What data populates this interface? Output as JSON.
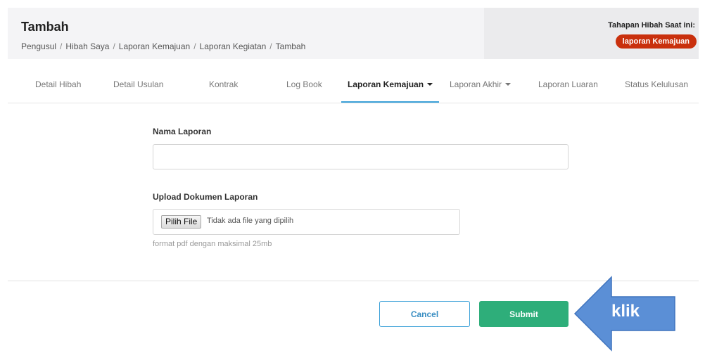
{
  "header": {
    "title": "Tambah",
    "breadcrumb": [
      "Pengusul",
      "Hibah Saya",
      "Laporan Kemajuan",
      "Laporan Kegiatan",
      "Tambah"
    ],
    "separator": "/",
    "stage_label": "Tahapan Hibah Saat ini:",
    "stage_badge": "laporan Kemajuan"
  },
  "tabs": [
    {
      "label": "Detail Hibah"
    },
    {
      "label": "Detail Usulan"
    },
    {
      "label": "Kontrak"
    },
    {
      "label": "Log Book"
    },
    {
      "label": "Laporan Kemajuan"
    },
    {
      "label": "Laporan Akhir"
    },
    {
      "label": "Laporan Luaran"
    },
    {
      "label": "Status Kelulusan"
    }
  ],
  "form": {
    "name_label": "Nama Laporan",
    "name_value": "",
    "upload_label": "Upload Dokumen Laporan",
    "file_button": "Pilih File",
    "file_status": "Tidak ada file yang dipilih",
    "help_text": "format pdf dengan maksimal 25mb"
  },
  "actions": {
    "cancel": "Cancel",
    "submit": "Submit"
  },
  "annotation": {
    "text": "klik",
    "color": "#5b8fd6"
  },
  "colors": {
    "accent": "#3aa0d8",
    "submit": "#2eae7a",
    "badge": "#c9300d"
  }
}
